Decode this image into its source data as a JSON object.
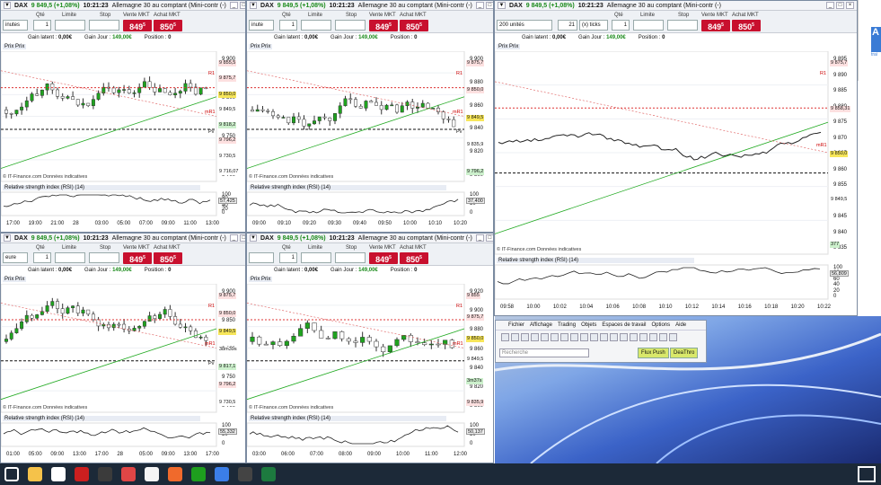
{
  "windows": [
    {
      "id": "w1",
      "units": "inutes",
      "title": "Allemagne 30 au comptant (Mini-contr (-)",
      "symbol": "DAX",
      "price_change": "9 849,5 (+1,08%)",
      "time": "10:21:23",
      "qte_label": "Qté",
      "qte_value": "1",
      "limite_label": "Limite",
      "stop_label": "Stop",
      "vente_label": "Vente MKT",
      "achat_label": "Achat MKT",
      "vente_price": "849",
      "vente_sup": "5",
      "achat_price": "850",
      "achat_sup": "5",
      "gain_latent_label": "Gain latent :",
      "gain_latent": "0,00€",
      "gain_jour_label": "Gain Jour :",
      "gain_jour": "149,00€",
      "position_label": "Position :",
      "position": "0",
      "chart_label": "Prix Prix",
      "yticks": [
        "9 900",
        "9 800",
        "9 750",
        "9 700"
      ],
      "tags": [
        "9 855,5",
        "9 875,7",
        "9 850,0",
        "9 849,5",
        "9 818,2",
        "9 796,2",
        "9 730,5",
        "9 716,07"
      ],
      "rsi_label": "Relative strength index (RSI) (14)",
      "rsi_value": "57,425",
      "rsi_ticks": [
        "100",
        "80",
        "60",
        "40",
        "20",
        "0"
      ],
      "xticks": [
        "17:00",
        "19:00",
        "21:00",
        "28",
        "03:00",
        "05:00",
        "07:00",
        "09:00",
        "11:00",
        "13:00"
      ],
      "credit": "© IT-Finance.com Données indicatives",
      "r1": "R1",
      "mr1": "mR1",
      "pv": "Pv"
    },
    {
      "id": "w2",
      "units": "inute",
      "title": "Allemagne 30 au comptant (Mini-contr (-)",
      "symbol": "DAX",
      "price_change": "9 849,5 (+1,08%)",
      "time": "10:21:23",
      "qte_label": "Qté",
      "qte_value": "1",
      "limite_label": "Limite",
      "stop_label": "Stop",
      "vente_label": "Vente MKT",
      "achat_label": "Achat MKT",
      "vente_price": "849",
      "vente_sup": "5",
      "achat_price": "850",
      "achat_sup": "5",
      "gain_latent_label": "Gain latent :",
      "gain_latent": "0,00€",
      "gain_jour_label": "Gain Jour :",
      "gain_jour": "149,00€",
      "position_label": "Position :",
      "position": "0",
      "chart_label": "Prix Prix",
      "yticks": [
        "9 900",
        "9 880",
        "9 860",
        "9 840",
        "9 820",
        "9 800"
      ],
      "tags": [
        "9 875,7",
        "9 850,0",
        "9 849,5",
        "9 835,9",
        "9 796,2"
      ],
      "rsi_label": "Relative strength index (RSI) (14)",
      "rsi_value": "37,400",
      "rsi_ticks": [
        "100",
        "50",
        "0"
      ],
      "xticks": [
        "09:00",
        "09:10",
        "09:20",
        "09:30",
        "09:40",
        "09:50",
        "10:00",
        "10:10",
        "10:20"
      ],
      "credit": "© IT-Finance.com Données indicatives",
      "r1": "R1",
      "mr1": "mR1",
      "pv": "Pv"
    },
    {
      "id": "w3",
      "units": "200 unités",
      "title": "Allemagne 30 au comptant (Mini-contr (-)",
      "symbol": "DAX",
      "price_change": "9 849,5 (+1,08%)",
      "time": "10:21:23",
      "ticks_count": "21",
      "ticks_label": "(x) ticks",
      "qte_label": "Qté",
      "qte_value": "1",
      "limite_label": "Limite",
      "stop_label": "Stop",
      "vente_label": "Vente MKT",
      "achat_label": "Achat MKT",
      "vente_price": "849",
      "vente_sup": "5",
      "achat_price": "850",
      "achat_sup": "5",
      "gain_latent_label": "Gain latent :",
      "gain_latent": "0,00€",
      "gain_jour_label": "Gain Jour :",
      "gain_jour": "149,00€",
      "position_label": "Position :",
      "position": "0",
      "chart_label": "Prix Prix",
      "yticks": [
        "9 895",
        "9 890",
        "9 885",
        "9 880",
        "9 875",
        "9 870",
        "9 865",
        "9 860",
        "9 855",
        "9 850",
        "9 845",
        "9 840",
        "9 835"
      ],
      "tags": [
        "9 875,7",
        "9 858,31",
        "9 850,0",
        "9 849,5",
        "377"
      ],
      "rsi_label": "Relative strength index (RSI) (14)",
      "rsi_value": "56,809",
      "rsi_ticks": [
        "100",
        "80",
        "60",
        "40",
        "20",
        "0"
      ],
      "xticks": [
        "09:58",
        "10:00",
        "10:02",
        "10:04",
        "10:06",
        "10:08",
        "10:10",
        "10:12",
        "10:14",
        "10:16",
        "10:18",
        "10:20",
        "10:22"
      ],
      "credit": "© IT-Finance.com Données indicatives",
      "r1": "R1",
      "mr1": "mR1"
    },
    {
      "id": "w4",
      "units": "eure",
      "title": "Allemagne 30 au comptant (Mini-contr (-)",
      "symbol": "DAX",
      "price_change": "9 849,5 (+1,08%)",
      "time": "10:21:23",
      "qte_label": "Qté",
      "qte_value": "1",
      "limite_label": "Limite",
      "stop_label": "Stop",
      "vente_label": "Vente MKT",
      "achat_label": "Achat MKT",
      "vente_price": "849",
      "vente_sup": "5",
      "achat_price": "850",
      "achat_sup": "5",
      "gain_latent_label": "Gain latent :",
      "gain_latent": "0,00€",
      "gain_jour_label": "Gain Jour :",
      "gain_jour": "149,00€",
      "position_label": "Position :",
      "position": "0",
      "chart_label": "Prix Prix",
      "yticks": [
        "9 900",
        "9 850",
        "9 800",
        "9 750",
        "9 700"
      ],
      "tags": [
        "9 875,7",
        "9 850,0",
        "9 849,5",
        "38m39s",
        "9 817,1",
        "9 796,2",
        "9 730,5"
      ],
      "rsi_label": "Relative strength index (RSI) (14)",
      "rsi_value": "55,332",
      "rsi_ticks": [
        "100",
        "50",
        "0"
      ],
      "xticks": [
        "01:00",
        "05:00",
        "09:00",
        "13:00",
        "17:00",
        "28",
        "05:00",
        "09:00",
        "13:00",
        "17:00"
      ],
      "credit": "© IT-Finance.com Données indicatives",
      "r1": "R1",
      "mr1": "mR1",
      "pv": "Pv"
    },
    {
      "id": "w5",
      "units": "",
      "title": "Allemagne 30 au comptant (Mini-contr (-)",
      "symbol": "DAX",
      "price_change": "9 849,5 (+1,08%)",
      "time": "10:21:23",
      "qte_label": "Qté",
      "qte_value": "1",
      "limite_label": "Limite",
      "stop_label": "Stop",
      "vente_label": "Vente MKT",
      "achat_label": "Achat MKT",
      "vente_price": "849",
      "vente_sup": "5",
      "achat_price": "850",
      "achat_sup": "5",
      "gain_latent_label": "Gain latent :",
      "gain_latent": "0,00€",
      "gain_jour_label": "Gain Jour :",
      "gain_jour": "149,00€",
      "position_label": "Position :",
      "position": "0",
      "chart_label": "Prix Prix",
      "yticks": [
        "9 920",
        "9 900",
        "9 880",
        "9 860",
        "9 840",
        "9 820",
        "9 800"
      ],
      "tags": [
        "9 855",
        "9 875,7",
        "9 850,0",
        "9 849,5",
        "3m37s",
        "9 835,9"
      ],
      "rsi_label": "Relative strength index (RSI) (14)",
      "rsi_value": "50,137",
      "rsi_ticks": [
        "100",
        "50",
        "0"
      ],
      "xticks": [
        "03:00",
        "06:00",
        "07:00",
        "08:00",
        "09:00",
        "10:00",
        "11:00",
        "12:00"
      ],
      "credit": "© IT-Finance.com Données indicatives",
      "r1": "R1",
      "mr1": "mR1"
    }
  ],
  "toolbar": {
    "menus": [
      "Fichier",
      "Affichage",
      "Trading",
      "Objets",
      "Espaces de travail",
      "Options",
      "Aide"
    ],
    "search_placeholder": "Recherche",
    "btn1": "Flux Push",
    "btn2": "DeaThro"
  },
  "side": {
    "letter": "A",
    "small": "trai"
  },
  "taskbar": {
    "icons": [
      "windows-start",
      "file-explorer",
      "search",
      "opera",
      "app-red",
      "chrome",
      "app-g",
      "chrome-2",
      "app-green",
      "app-l3",
      "charts-app",
      "excel"
    ]
  }
}
